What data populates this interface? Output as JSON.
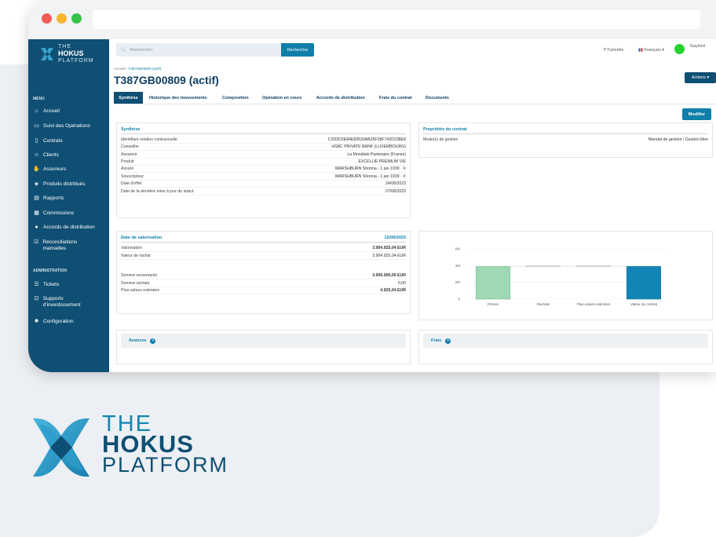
{
  "brand": {
    "line1": "THE",
    "line2": "HOKUS",
    "line3": "PLATFORM",
    "color": "#0f4f73",
    "accent": "#1386b0"
  },
  "topbar": {
    "search_placeholder": "Rechercher",
    "search_button": "Recherche",
    "tutorials": "Tutoriels",
    "language": "Français",
    "user": "Gaylord"
  },
  "sidebar": {
    "menu_title": "MENU",
    "items": [
      {
        "label": "Accueil",
        "icon": "home-icon",
        "glyph": "⌂"
      },
      {
        "label": "Suivi des Opérations",
        "icon": "inbox-icon",
        "glyph": "▭"
      },
      {
        "label": "Contrats",
        "icon": "file-icon",
        "glyph": "▯"
      },
      {
        "label": "Clients",
        "icon": "users-icon",
        "glyph": "☺"
      },
      {
        "label": "Assureurs",
        "icon": "handshake-icon",
        "glyph": "✋"
      },
      {
        "label": "Produits distribués",
        "icon": "box-icon",
        "glyph": "◈"
      },
      {
        "label": "Rapports",
        "icon": "report-icon",
        "glyph": "▤"
      },
      {
        "label": "Commissions",
        "icon": "money-icon",
        "glyph": "▦"
      },
      {
        "label": "Accords de distribution",
        "icon": "coin-icon",
        "glyph": "●"
      },
      {
        "label": "Réconciliations manuelles",
        "icon": "checkbox-icon",
        "glyph": "☑"
      }
    ],
    "admin_title": "ADMINISTRATION",
    "admin_items": [
      {
        "label": "Tickets",
        "icon": "list-icon",
        "glyph": "☰"
      },
      {
        "label": "Supports d'investissement",
        "icon": "support-icon",
        "glyph": "⊡"
      },
      {
        "label": "Configuration",
        "icon": "gear-icon",
        "glyph": "✹"
      }
    ]
  },
  "breadcrumb": {
    "home": "Accueil",
    "current": "T387GB00809 (actif)"
  },
  "page_title": "T387GB00809 (actif)",
  "actions_label": "Actions ▾",
  "tabs": [
    "Synthèse",
    "Historique des mouvements",
    "Composition",
    "Opération en cours",
    "Accords de distribution",
    "Frais du contrat",
    "Documents"
  ],
  "modifier_label": "Modifier",
  "synthese": {
    "title": "Synthèse",
    "rows": [
      {
        "label": "Identifiant relation contractuelle",
        "value": "C20DD2E84E83530AB25F28F742D238E8"
      },
      {
        "label": "Conseiller",
        "value": "HSBC PRIVATE BANK (LUXEMBOURG)"
      },
      {
        "label": "Assureur",
        "value": "La Mondiale Partenaire (France)"
      },
      {
        "label": "Produit",
        "value": "EXCELLIE PREMIUM VIE"
      },
      {
        "label": "Assuré",
        "value": "MARSHBURN Shonna - 1 jan 1939 · ⚲"
      },
      {
        "label": "Souscripteur",
        "value": "MARSHBURN Shonna - 1 jan 1939 · ⚲"
      },
      {
        "label": "Date d'effet",
        "value": "24/08/2023"
      },
      {
        "label": "Date de la dernière mise à jour du statut",
        "value": "07/08/2023"
      }
    ]
  },
  "proprietes": {
    "title": "Propriétés du contrat",
    "rows": [
      {
        "label": "Mode(s) de gestion",
        "value": "Mandat de gestion / Gestion libre"
      }
    ]
  },
  "valorisation": {
    "title": "Date de valorisation",
    "date": "12/09/2023",
    "rows": [
      {
        "label": "Valorisation",
        "value": "3.904.925,04 EUR"
      },
      {
        "label": "Valeur de rachat",
        "value": "3.904.925,04 EUR"
      }
    ],
    "rows2": [
      {
        "label": "Somme versements",
        "value": "3.900.000,00 EUR"
      },
      {
        "label": "Somme rachats",
        "value": "0,00"
      },
      {
        "label": "Plus-values estimées",
        "value": "4.925,04 EUR"
      }
    ]
  },
  "chart_data": {
    "type": "bar",
    "categories": [
      "Primes",
      "Rachats",
      "Plus-values estimées",
      "Valeur du contrat"
    ],
    "values": [
      3900000,
      0,
      4925.04,
      3904925.04
    ],
    "colors": [
      "#9fd8b4",
      "#cccccc",
      "#cccccc",
      "#1385b5"
    ],
    "ytick_labels": [
      "6M",
      "4M",
      "2M",
      "0"
    ],
    "ylim": [
      0,
      6000000
    ]
  },
  "accordions": {
    "avances": "Avances",
    "frais": "Frais"
  }
}
